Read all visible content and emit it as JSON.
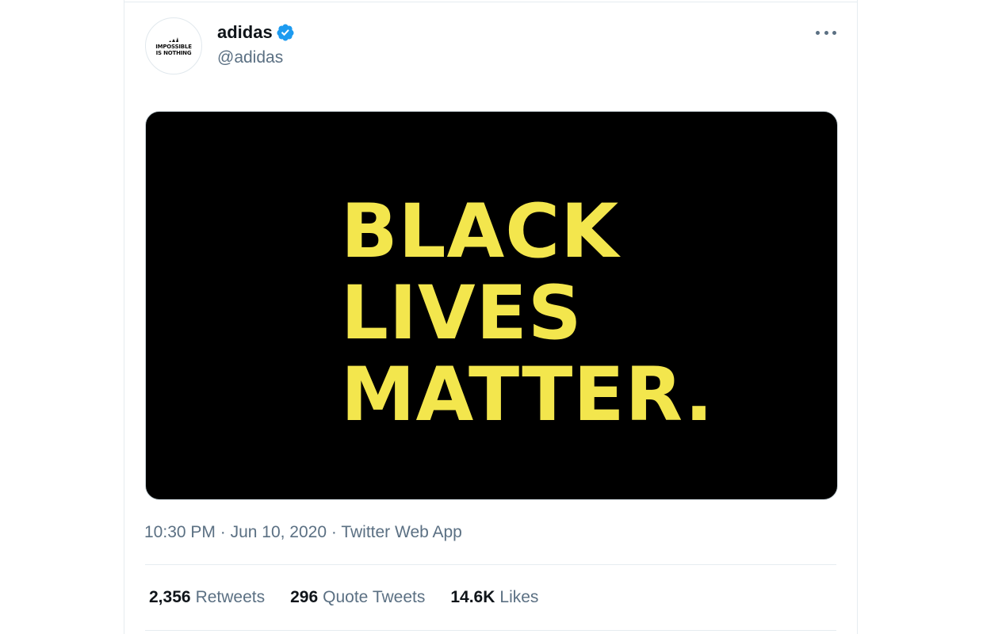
{
  "tweet": {
    "author": {
      "display_name": "adidas",
      "handle": "@adidas",
      "verified": true,
      "avatar_text": "IMPOSSIBLE\nIS NOTHING",
      "avatar_icon": "adidas-logo-icon"
    },
    "more_icon": "more-horizontal-icon",
    "media": {
      "lines": [
        "BLACK",
        "LIVES",
        "MATTER."
      ],
      "background_color": "#000000",
      "text_color": "#f3e64d"
    },
    "timestamp": {
      "time": "10:30 PM",
      "date": "Jun 10, 2020",
      "source": "Twitter Web App",
      "separator": "·"
    },
    "stats": [
      {
        "count": "2,356",
        "label": "Retweets"
      },
      {
        "count": "296",
        "label": "Quote Tweets"
      },
      {
        "count": "14.6K",
        "label": "Likes"
      }
    ]
  },
  "colors": {
    "verified_badge": "#1d9bf0",
    "secondary_text": "#5b7083",
    "primary_text": "#0f1419"
  }
}
